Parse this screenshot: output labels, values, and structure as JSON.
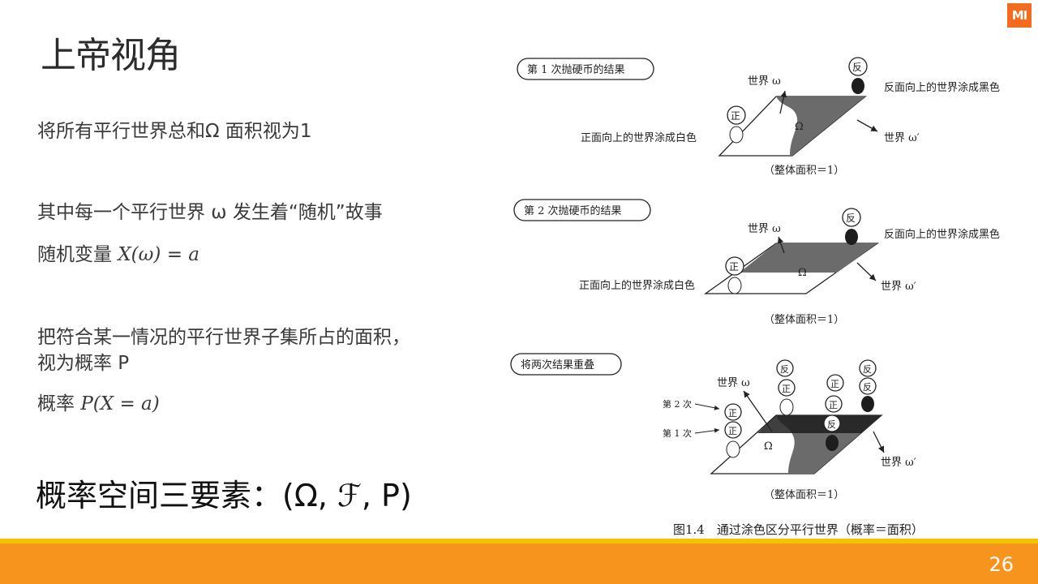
{
  "slide": {
    "title": "上帝视角",
    "logo_text": "MI",
    "page_number": "26",
    "lines": {
      "l1": "将所有平行世界总和Ω 面积视为1",
      "l2": "其中每一个平行世界 ω 发生着“随机”故事",
      "l3_text": "随机变量 ",
      "l3_math": "X(ω) = a",
      "l4": "把符合某一情况的平行世界子集所占的面积，",
      "l5": "视为概率 P",
      "l6_text": "概率 ",
      "l6_math": "P(X = a)"
    },
    "big_text": "概率空间三要素：(Ω, ℱ, P)"
  },
  "figure": {
    "panels": [
      {
        "label": "第 1 次抛硬币的结果",
        "world_label": "世界 ω",
        "world_prime_label": "世界 ω′",
        "black_note": "反面向上的世界涂成黑色",
        "white_note": "正面向上的世界涂成白色",
        "omega": "Ω",
        "area_note": "（整体面积＝1）"
      },
      {
        "label": "第 2 次抛硬币的结果",
        "world_label": "世界 ω",
        "world_prime_label": "世界 ω′",
        "black_note": "反面向上的世界涂成黑色",
        "white_note": "正面向上的世界涂成白色",
        "omega": "Ω",
        "area_note": "（整体面积＝1）"
      },
      {
        "label": "将两次结果重叠",
        "world_label": "世界 ω",
        "world_prime_label": "世界 ω′",
        "second_label": "第 2 次",
        "first_label": "第 1 次",
        "omega": "Ω",
        "area_note": "（整体面积＝1）"
      }
    ],
    "coin_head": "正",
    "coin_tail": "反",
    "caption": "图1.4　通过涂色区分平行世界（概率＝面积）"
  },
  "colors": {
    "accent_orange": "#f7941d",
    "accent_yellow": "#f5c400",
    "logo_orange": "#f46c1b",
    "gray_region": "#6b6b6b",
    "black_region": "#1d1d1d"
  }
}
